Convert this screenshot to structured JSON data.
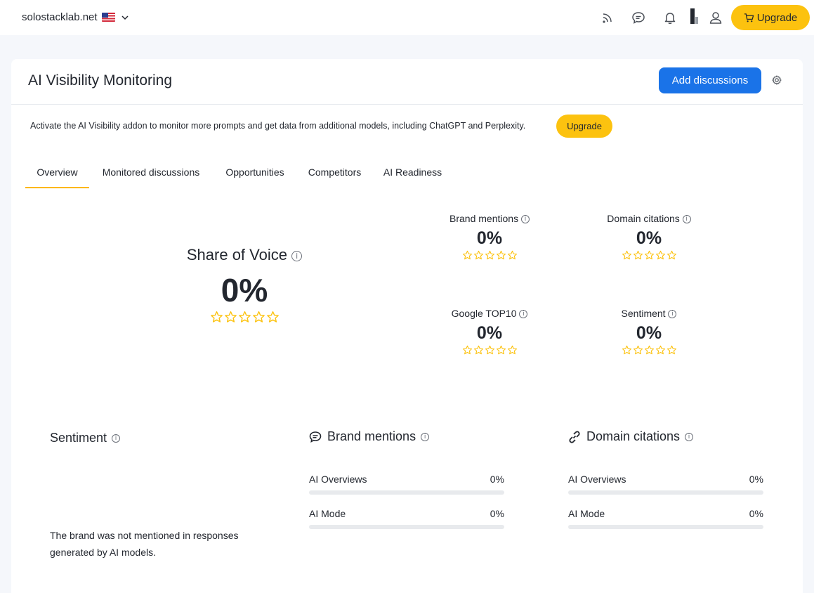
{
  "header": {
    "domain": "solostacklab.net",
    "upgrade_label": "Upgrade",
    "icons": [
      "rss-icon",
      "chat-icon",
      "bell-icon",
      "brand-logo-icon",
      "user-icon"
    ]
  },
  "page": {
    "title": "AI Visibility Monitoring",
    "add_button": "Add discussions",
    "notice": "Activate the AI Visibility addon to monitor more prompts and get data from additional models, including ChatGPT and Perplexity.",
    "notice_button": "Upgrade"
  },
  "tabs": [
    {
      "label": "Overview",
      "active": true
    },
    {
      "label": "Monitored discussions",
      "active": false
    },
    {
      "label": "Opportunities",
      "active": false
    },
    {
      "label": "Competitors",
      "active": false
    },
    {
      "label": "AI Readiness",
      "active": false
    }
  ],
  "share_of_voice": {
    "label": "Share of Voice",
    "value": "0%",
    "stars": 0
  },
  "metrics": [
    {
      "label": "Brand mentions",
      "value": "0%",
      "stars": 0
    },
    {
      "label": "Domain citations",
      "value": "0%",
      "stars": 0
    },
    {
      "label": "Google TOP10",
      "value": "0%",
      "stars": 0
    },
    {
      "label": "Sentiment",
      "value": "0%",
      "stars": 0
    }
  ],
  "sentiment_section": {
    "title": "Sentiment",
    "message": "The brand was not mentioned in responses generated by AI models."
  },
  "brand_mentions_section": {
    "title": "Brand mentions",
    "rows": [
      {
        "label": "AI Overviews",
        "value": "0%",
        "fraction": 0
      },
      {
        "label": "AI Mode",
        "value": "0%",
        "fraction": 0
      }
    ]
  },
  "domain_citations_section": {
    "title": "Domain citations",
    "rows": [
      {
        "label": "AI Overviews",
        "value": "0%",
        "fraction": 0
      },
      {
        "label": "AI Mode",
        "value": "0%",
        "fraction": 0
      }
    ]
  },
  "colors": {
    "accent": "#1a73e8",
    "upgrade": "#fcc20f",
    "star": "#fcc20f",
    "tab_underline": "#fcb714"
  }
}
